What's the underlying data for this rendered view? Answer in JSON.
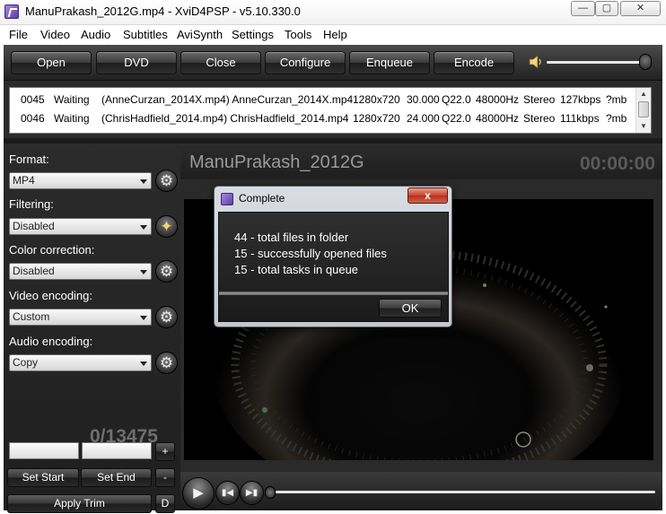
{
  "window": {
    "title": "ManuPrakash_2012G.mp4  -  XviD4PSP  -  v5.10.330.0",
    "minimize": "▭",
    "maximize": "▢",
    "close": "✕"
  },
  "menu": {
    "items": [
      "File",
      "Video",
      "Audio",
      "Subtitles",
      "AviSynth",
      "Settings",
      "Tools",
      "Help"
    ]
  },
  "toolbar": {
    "buttons": [
      "Open",
      "DVD",
      "Close",
      "Configure",
      "Enqueue",
      "Encode"
    ],
    "volume_level": 0.95
  },
  "queue": {
    "rows": [
      {
        "num": "0045",
        "status": "Waiting",
        "file": "(AnneCurzan_2014X.mp4) AnneCurzan_2014X.mp4",
        "resolution": "1280x720",
        "fps": "30.000",
        "quality": "Q22.0",
        "audio_rate": "48000Hz",
        "channels": "Stereo",
        "bitrate": "127kbps",
        "size": "?mb"
      },
      {
        "num": "0046",
        "status": "Waiting",
        "file": "(ChrisHadfield_2014.mp4) ChrisHadfield_2014.mp4",
        "resolution": "1280x720",
        "fps": "24.000",
        "quality": "Q22.0",
        "audio_rate": "48000Hz",
        "channels": "Stereo",
        "bitrate": "111kbps",
        "size": "?mb"
      }
    ]
  },
  "settings": {
    "format_label": "Format:",
    "format_value": "MP4",
    "filtering_label": "Filtering:",
    "filtering_value": "Disabled",
    "color_label": "Color correction:",
    "color_value": "Disabled",
    "video_label": "Video encoding:",
    "video_value": "Custom",
    "audio_label": "Audio encoding:",
    "audio_value": "Copy"
  },
  "trim": {
    "start_value": "",
    "end_value": "",
    "plus": "+",
    "set_start": "Set Start",
    "set_end": "Set End",
    "minus": "-",
    "apply": "Apply Trim",
    "d": "D"
  },
  "preview": {
    "file_title": "ManuPrakash_2012G",
    "timecode": "00:00:00",
    "frame_counter": "0/13475",
    "seek_position": 0
  },
  "dialog": {
    "title": "Complete",
    "close": "x",
    "lines": [
      "44 - total files in folder",
      "15 - successfully opened files",
      "15 - total tasks in queue"
    ],
    "ok": "OK"
  },
  "colors": {
    "panel_dark": "#2a2a2a",
    "accent_purple": "#5a3fa0",
    "close_red": "#c8412b"
  }
}
